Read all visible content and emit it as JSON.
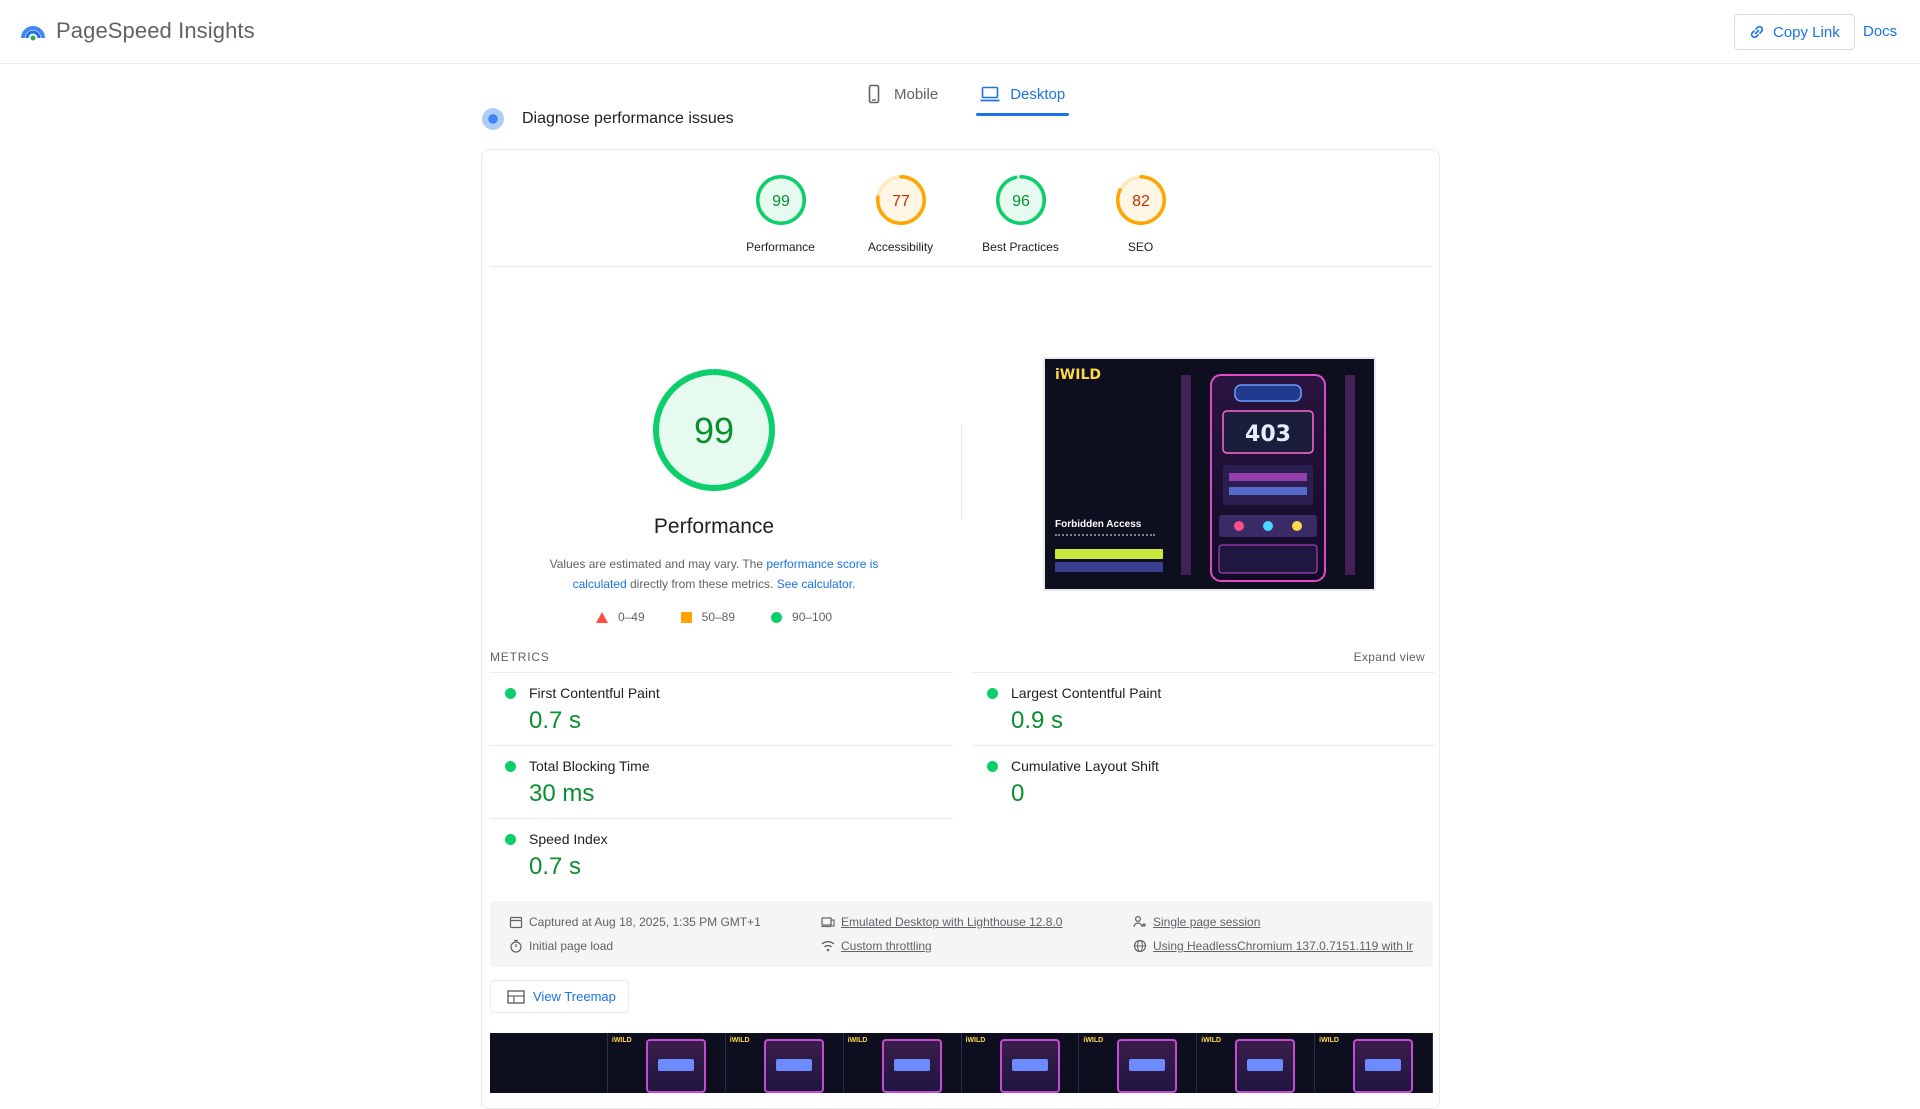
{
  "header": {
    "app_name": "PageSpeed Insights",
    "copy_link_label": "Copy Link",
    "docs_label": "Docs"
  },
  "tabs": [
    {
      "label": "Mobile",
      "icon": "phone-icon",
      "active": false
    },
    {
      "label": "Desktop",
      "icon": "laptop-icon",
      "active": true
    }
  ],
  "diagnose_title": "Diagnose performance issues",
  "category_scores": [
    {
      "score": "99",
      "label": "Performance",
      "color": "#0cce6b",
      "fraction": 0.99
    },
    {
      "score": "77",
      "label": "Accessibility",
      "color": "#ffa400",
      "fraction": 0.77
    },
    {
      "score": "96",
      "label": "Best Practices",
      "color": "#0cce6b",
      "fraction": 0.96
    },
    {
      "score": "82",
      "label": "SEO",
      "color": "#ffa400",
      "fraction": 0.82
    }
  ],
  "performance": {
    "score": "99",
    "fraction": 0.99,
    "title": "Performance",
    "note_prefix": "Values are estimated and may vary. The ",
    "note_link1": "performance score is calculated",
    "note_middle": " directly from these metrics. ",
    "note_link2": "See calculator."
  },
  "legend": [
    {
      "range": "0–49",
      "shape": "triangle",
      "color": "#ff4e42"
    },
    {
      "range": "50–89",
      "shape": "square",
      "color": "#ffa400"
    },
    {
      "range": "90–100",
      "shape": "circle",
      "color": "#0cce6b"
    }
  ],
  "screenshot": {
    "logo": "iWILD",
    "heading": "Forbidden Access",
    "slot_digits": "403"
  },
  "metrics": {
    "section_label": "METRICS",
    "expand_label": "Expand view",
    "left": [
      {
        "name": "First Contentful Paint",
        "value": "0.7 s"
      },
      {
        "name": "Total Blocking Time",
        "value": "30 ms"
      },
      {
        "name": "Speed Index",
        "value": "0.7 s"
      }
    ],
    "right": [
      {
        "name": "Largest Contentful Paint",
        "value": "0.9 s"
      },
      {
        "name": "Cumulative Layout Shift",
        "value": "0"
      }
    ]
  },
  "run_info": {
    "captured": "Captured at Aug 18, 2025, 1:35 PM GMT+1",
    "initial_load": "Initial page load",
    "emulated": "Emulated Desktop with Lighthouse 12.8.0",
    "throttling": "Custom throttling",
    "session": "Single page session",
    "browser": "Using HeadlessChromium 137.0.7151.119 with lr"
  },
  "treemap_label": "View Treemap",
  "colors": {
    "accent": "#1a73e8",
    "pass": "#0cce6b",
    "average": "#ffa400",
    "fail": "#ff4e42"
  }
}
